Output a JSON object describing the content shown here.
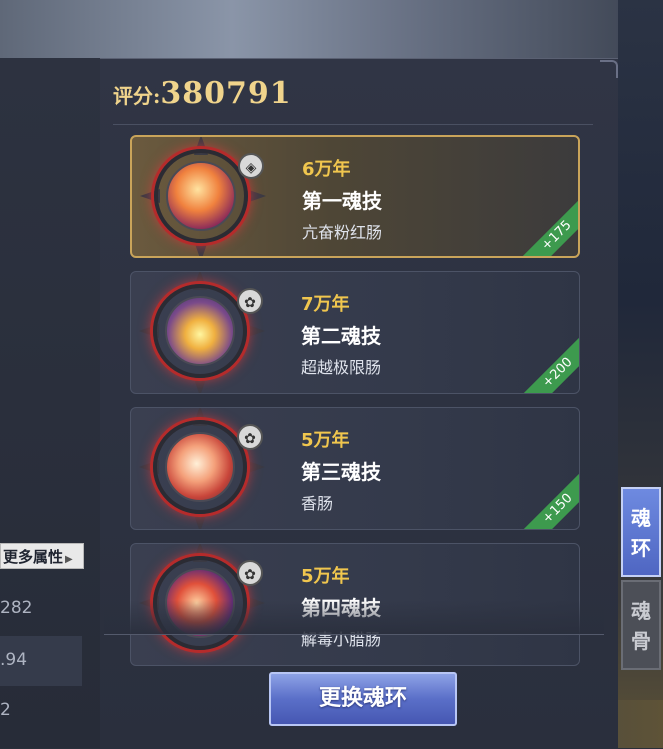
{
  "score": {
    "label": "评分:",
    "value": "380791"
  },
  "left_panel": {
    "more_attributes": "更多属性",
    "stat_values": [
      "282",
      ".94",
      "2"
    ]
  },
  "rings": [
    {
      "years": "6万年",
      "skill": "第一魂技",
      "name": "亢奋粉红肠",
      "bonus": "+175",
      "selected": true
    },
    {
      "years": "7万年",
      "skill": "第二魂技",
      "name": "超越极限肠",
      "bonus": "+200",
      "selected": false
    },
    {
      "years": "5万年",
      "skill": "第三魂技",
      "name": "香肠",
      "bonus": "+150",
      "selected": false
    },
    {
      "years": "5万年",
      "skill": "第四魂技",
      "name": "解毒小腊肠",
      "bonus": "",
      "selected": false
    }
  ],
  "change_button": "更换魂环",
  "tabs": [
    {
      "label_top": "魂",
      "label_bottom": "环",
      "active": true
    },
    {
      "label_top": "魂",
      "label_bottom": "骨",
      "active": false
    }
  ],
  "colors": {
    "gold": "#f0c64e",
    "accent_blue": "#5a6fc8",
    "bonus_green": "#3d9a4e"
  }
}
